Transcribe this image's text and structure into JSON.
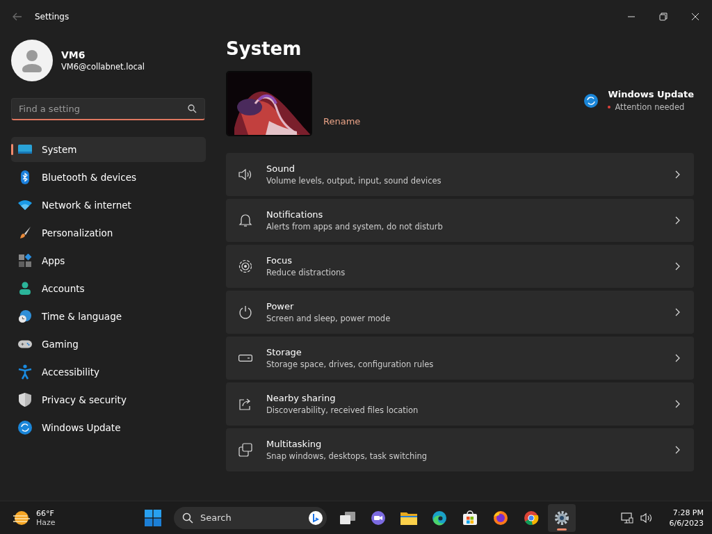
{
  "window": {
    "title": "Settings"
  },
  "user": {
    "name": "VM6",
    "email": "VM6@collabnet.local"
  },
  "search": {
    "placeholder": "Find a setting"
  },
  "nav": [
    {
      "kind": "system",
      "label": "System",
      "selected": true
    },
    {
      "kind": "bluetooth",
      "label": "Bluetooth & devices",
      "selected": false
    },
    {
      "kind": "network",
      "label": "Network & internet",
      "selected": false
    },
    {
      "kind": "personalization",
      "label": "Personalization",
      "selected": false
    },
    {
      "kind": "apps",
      "label": "Apps",
      "selected": false
    },
    {
      "kind": "accounts",
      "label": "Accounts",
      "selected": false
    },
    {
      "kind": "time",
      "label": "Time & language",
      "selected": false
    },
    {
      "kind": "gaming",
      "label": "Gaming",
      "selected": false
    },
    {
      "kind": "accessibility",
      "label": "Accessibility",
      "selected": false
    },
    {
      "kind": "privacy",
      "label": "Privacy & security",
      "selected": false
    },
    {
      "kind": "update",
      "label": "Windows Update",
      "selected": false
    }
  ],
  "page": {
    "title": "System",
    "rename": "Rename",
    "update": {
      "title": "Windows Update",
      "status": "Attention needed"
    }
  },
  "cards": [
    {
      "kind": "sound",
      "title": "Sound",
      "subtitle": "Volume levels, output, input, sound devices"
    },
    {
      "kind": "notifications",
      "title": "Notifications",
      "subtitle": "Alerts from apps and system, do not disturb"
    },
    {
      "kind": "focus",
      "title": "Focus",
      "subtitle": "Reduce distractions"
    },
    {
      "kind": "power",
      "title": "Power",
      "subtitle": "Screen and sleep, power mode"
    },
    {
      "kind": "storage",
      "title": "Storage",
      "subtitle": "Storage space, drives, configuration rules"
    },
    {
      "kind": "nearby",
      "title": "Nearby sharing",
      "subtitle": "Discoverability, received files location"
    },
    {
      "kind": "multitasking",
      "title": "Multitasking",
      "subtitle": "Snap windows, desktops, task switching"
    }
  ],
  "taskbar": {
    "weather": {
      "temp": "66°F",
      "condition": "Haze"
    },
    "search": {
      "placeholder": "Search"
    },
    "apps": [
      {
        "kind": "taskview",
        "selected": false
      },
      {
        "kind": "chat",
        "selected": false
      },
      {
        "kind": "explorer",
        "selected": false
      },
      {
        "kind": "edge",
        "selected": false
      },
      {
        "kind": "store",
        "selected": false
      },
      {
        "kind": "firefox",
        "selected": false
      },
      {
        "kind": "chrome",
        "selected": false
      },
      {
        "kind": "settings",
        "selected": true
      }
    ],
    "time": "7:28 PM",
    "date": "6/6/2023"
  }
}
